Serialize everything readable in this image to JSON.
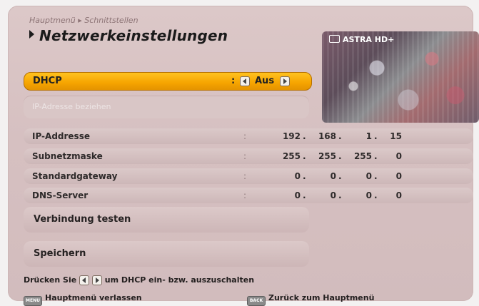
{
  "breadcrumb": "Hauptmenü ▸ Schnittstellen",
  "title": "Netzwerkeinstellungen",
  "preview": {
    "channel": "ASTRA HD+",
    "icon": "tv-icon"
  },
  "dhcp": {
    "label": "DHCP",
    "colon": ":",
    "value": "Aus"
  },
  "ip_button": {
    "label": "IP-Adresse beziehen",
    "enabled": false
  },
  "rows": [
    {
      "name": "IP-Addresse",
      "octets": [
        "192",
        "168",
        "1",
        "15"
      ]
    },
    {
      "name": "Subnetzmaske",
      "octets": [
        "255",
        "255",
        "255",
        "0"
      ]
    },
    {
      "name": "Standardgateway",
      "octets": [
        "0",
        "0",
        "0",
        "0"
      ]
    },
    {
      "name": "DNS-Server",
      "octets": [
        "0",
        "0",
        "0",
        "0"
      ]
    }
  ],
  "colon": ":",
  "dot": ".",
  "buttons": {
    "test": "Verbindung testen",
    "save": "Speichern"
  },
  "hint": {
    "pre": "Drücken Sie",
    "post": "um DHCP ein- bzw. auszuschalten"
  },
  "footer": {
    "menu_key": "MENU",
    "menu_label": "Hauptmenü verlassen",
    "back_key": "BACK",
    "back_label": "Zurück zum Hauptmenü"
  },
  "colors": {
    "accent": "#f6a400",
    "panel": "#d6c0c1"
  }
}
